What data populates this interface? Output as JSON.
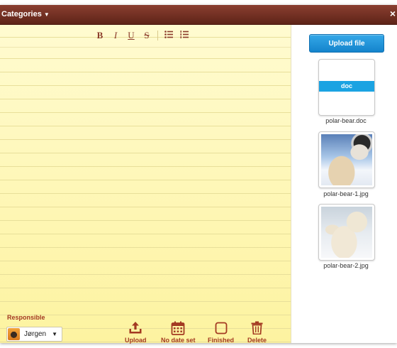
{
  "header": {
    "categories_label": "Categories",
    "close_glyph": "×"
  },
  "toolbar": {
    "bold": "B",
    "italic": "I",
    "underline": "U",
    "strike": "S"
  },
  "footer": {
    "responsible_label": "Responsible",
    "responsible_value": "Jørgen",
    "actions": {
      "upload": "Upload",
      "date": "No date set",
      "finished": "Finished",
      "delete": "Delete"
    }
  },
  "files": {
    "upload_button": "Upload file",
    "items": [
      {
        "type_badge": "doc",
        "name": "polar-bear.doc"
      },
      {
        "name": "polar-bear-1.jpg"
      },
      {
        "name": "polar-bear-2.jpg"
      }
    ]
  },
  "colors": {
    "titlebar": "#6e2e22",
    "accent_text": "#a33a22",
    "upload_button": "#1a95dd",
    "note_paper": "#fdf6a8"
  }
}
